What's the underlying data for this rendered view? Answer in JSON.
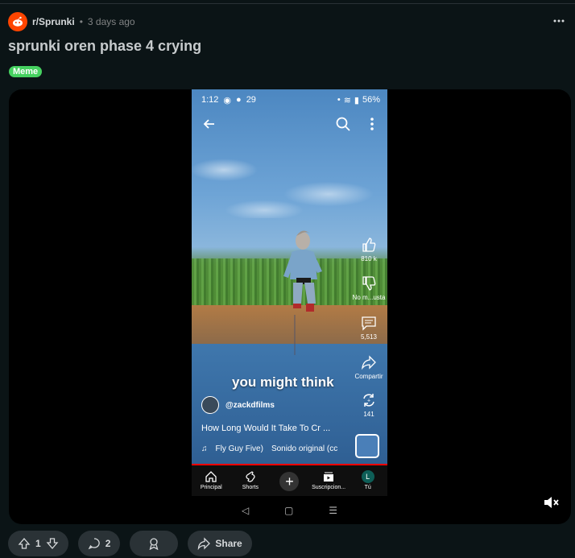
{
  "post": {
    "subreddit": "r/Sprunki",
    "separator": "•",
    "time": "3 days ago",
    "title": "sprunki oren phase 4 crying",
    "flair": "Meme",
    "flair_color": "#46d160",
    "upvotes": "1",
    "comments": "2",
    "share_label": "Share"
  },
  "video": {
    "status_time": "1:12",
    "status_extra": "29",
    "battery": "56%",
    "caption": "you might think",
    "channel": "@zackdfilms",
    "title": "How Long Would It Take To Cr ...",
    "music_artist": "Fly Guy Five)",
    "music_sound": "Sonido original (cc",
    "like_count": "810 k",
    "dislike_label": "No m...usta",
    "comment_count": "5,513",
    "share_label": "Compartir",
    "remix_count": "141",
    "progress": 1.0
  },
  "nav": {
    "home": "Principal",
    "shorts": "Shorts",
    "plus": "+",
    "subs": "Suscripcion...",
    "you_initial": "L",
    "you": "Tú"
  },
  "system": {
    "back": "◁",
    "home": "▢",
    "recents": "☰"
  },
  "colors": {
    "accent": "#ff4500",
    "background": "#0b1416",
    "pill": "#2a3236"
  }
}
